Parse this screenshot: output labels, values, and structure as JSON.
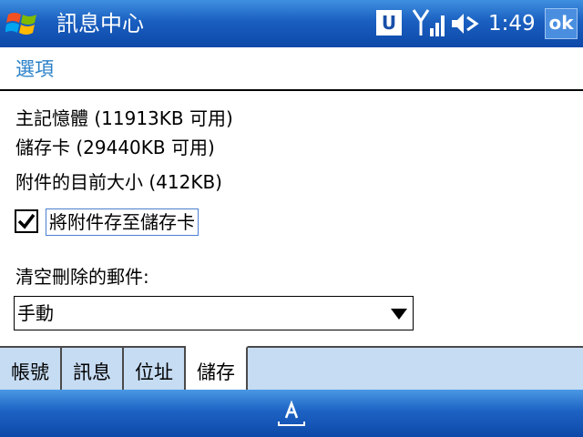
{
  "titlebar": {
    "title": "訊息中心",
    "u_label": "U",
    "time": "1:49",
    "ok_label": "ok"
  },
  "section": {
    "title": "選項"
  },
  "info": {
    "main_memory": "主記憶體 (11913KB 可用)",
    "storage_card": "儲存卡 (29440KB 可用)",
    "attachment_size": "附件的目前大小 (412KB)"
  },
  "checkbox": {
    "label": "將附件存至儲存卡",
    "checked": true
  },
  "empty_deleted": {
    "label": "清空刪除的郵件:",
    "value": "手動"
  },
  "tabs": [
    {
      "label": "帳號"
    },
    {
      "label": "訊息"
    },
    {
      "label": "位址"
    },
    {
      "label": "儲存"
    }
  ],
  "icons": {
    "start": "windows-flag-icon",
    "signal": "signal-strength-icon",
    "volume": "speaker-muted-icon",
    "keyboard": "input-panel-icon"
  },
  "colors": {
    "titlebar": "#1a5fc0",
    "section_title": "#2a80c8",
    "tab_bg": "#c6dcf3"
  }
}
